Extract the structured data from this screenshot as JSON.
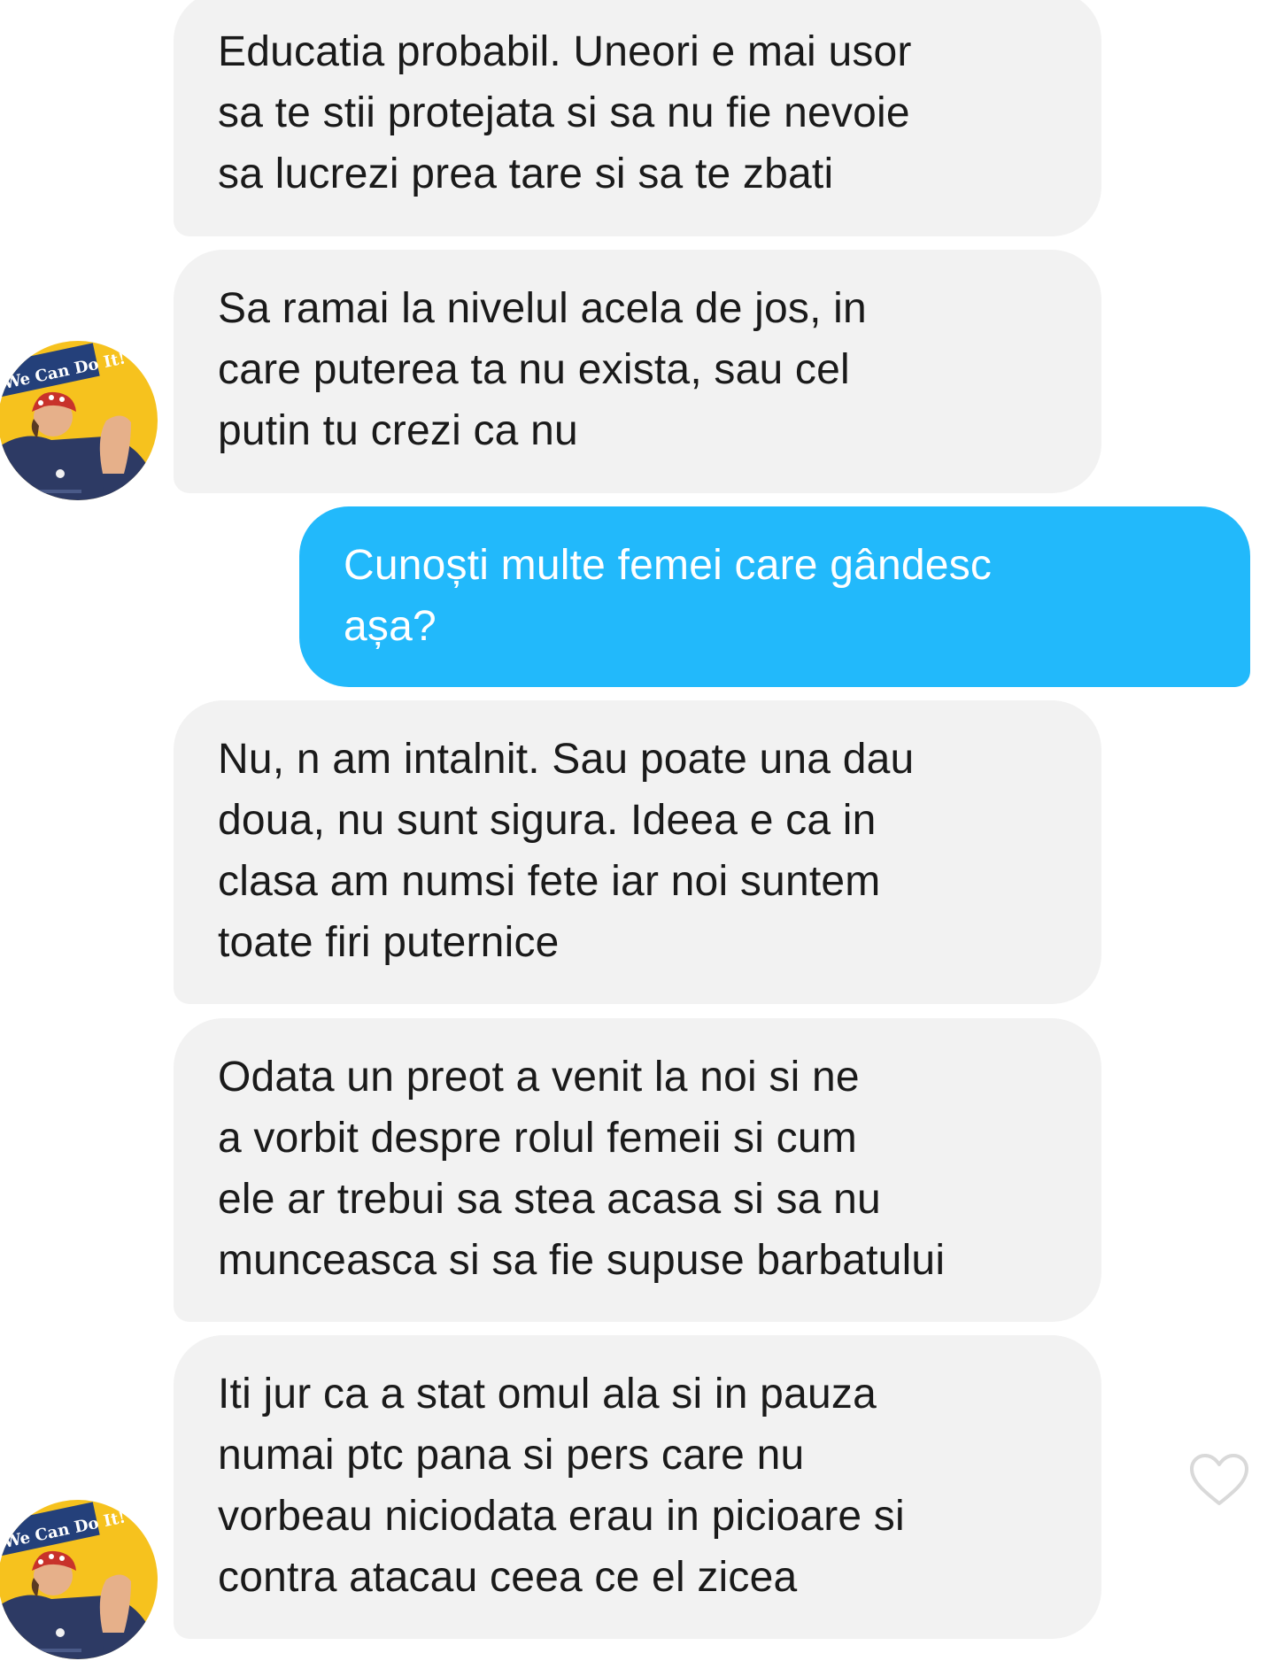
{
  "messages": [
    {
      "direction": "in",
      "lines": [
        "Educatia probabil. Uneori e mai usor",
        "sa te stii protejata si sa nu fie nevoie",
        "sa lucrezi prea tare si sa te zbati"
      ]
    },
    {
      "direction": "in",
      "lines": [
        "Sa ramai la nivelul acela de jos, in",
        "care puterea ta nu exista, sau cel",
        "putin tu crezi ca nu"
      ]
    },
    {
      "direction": "out",
      "lines": [
        "Cunoști multe femei care gândesc",
        "așa?"
      ]
    },
    {
      "direction": "in",
      "lines": [
        "Nu, n am intalnit. Sau poate una dau",
        "doua, nu sunt sigura. Ideea e ca in",
        "clasa am numsi fete iar noi suntem",
        "toate firi puternice"
      ]
    },
    {
      "direction": "in",
      "lines": [
        "Odata un preot a venit la noi si ne",
        "a vorbit despre rolul femeii si cum",
        "ele ar trebui sa stea acasa si sa nu",
        "munceasca si sa fie supuse barbatului"
      ]
    },
    {
      "direction": "in",
      "lines": [
        "Iti jur ca a stat omul ala si in pauza",
        "numai ptc pana si pers care nu",
        "vorbeau niciodata erau in picioare si",
        "contra atacau ceea ce el zicea"
      ]
    }
  ],
  "avatar": {
    "poster_text": "We Can Do It!",
    "icon": "we-can-do-it-poster"
  },
  "like_icon": "heart-outline-icon",
  "colors": {
    "incoming_bubble": "#f2f2f2",
    "outgoing_bubble": "#22b9fb",
    "incoming_text": "#1a1a1a",
    "outgoing_text": "#ffffff",
    "avatar_background": "#f6c21e",
    "avatar_shirt": "#2d3a64",
    "like_outline": "#d9d9d9"
  }
}
